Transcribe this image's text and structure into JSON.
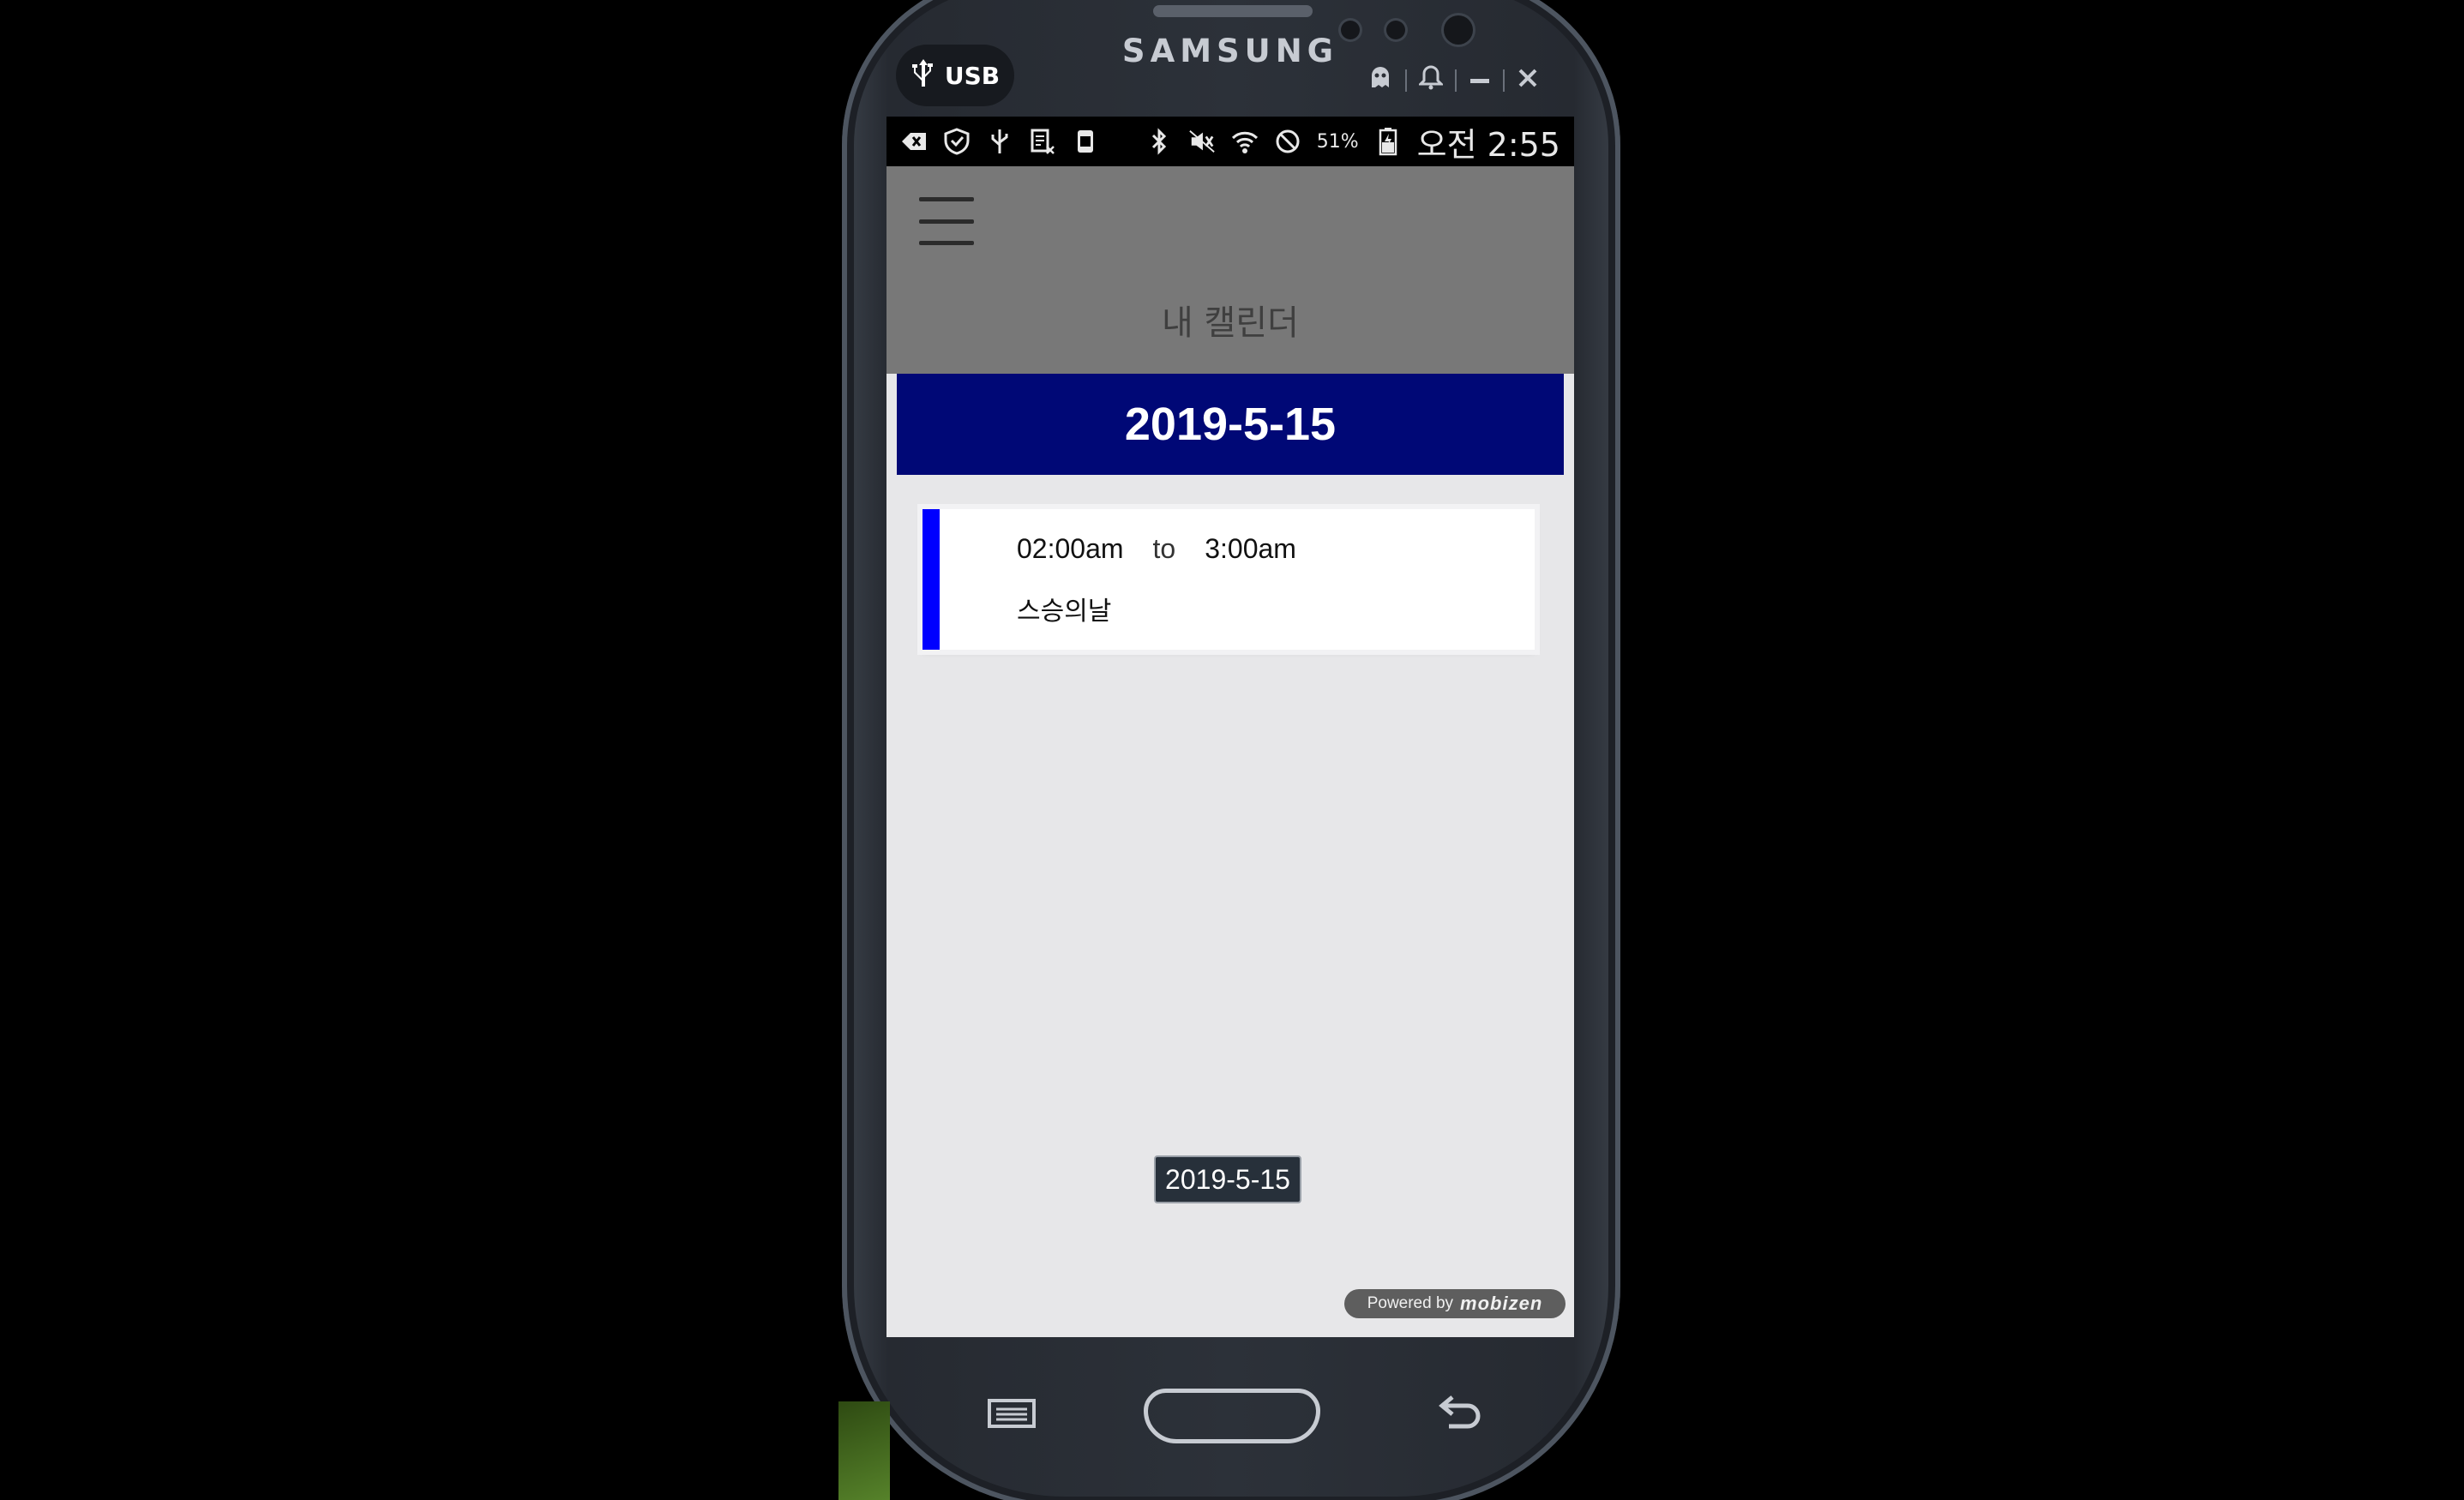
{
  "device": {
    "brand": "SAMSUNG",
    "usb_label": "USB"
  },
  "status_bar": {
    "battery_percent": "51%",
    "time": "오전 2:55",
    "icons_left": [
      "back-arrow-icon",
      "shield-icon",
      "usb-icon",
      "sim-icon",
      "app-icon"
    ],
    "icons_right": [
      "bluetooth-icon",
      "mute-icon",
      "wifi-icon",
      "block-icon",
      "battery-icon"
    ]
  },
  "app": {
    "title": "내 캘린더",
    "date_header": "2019-5-15",
    "events": [
      {
        "start": "02:00am",
        "connector": "to",
        "end": "3:00am",
        "title": "스승의날",
        "color": "#0000ff"
      }
    ],
    "toast": "2019-5-15",
    "powered_by": "Powered by",
    "powered_brand": "mobizen"
  },
  "colors": {
    "header_bg": "#000876",
    "topbar_bg": "#787878",
    "content_bg": "#e7e7e9",
    "event_accent": "#0000ff"
  }
}
